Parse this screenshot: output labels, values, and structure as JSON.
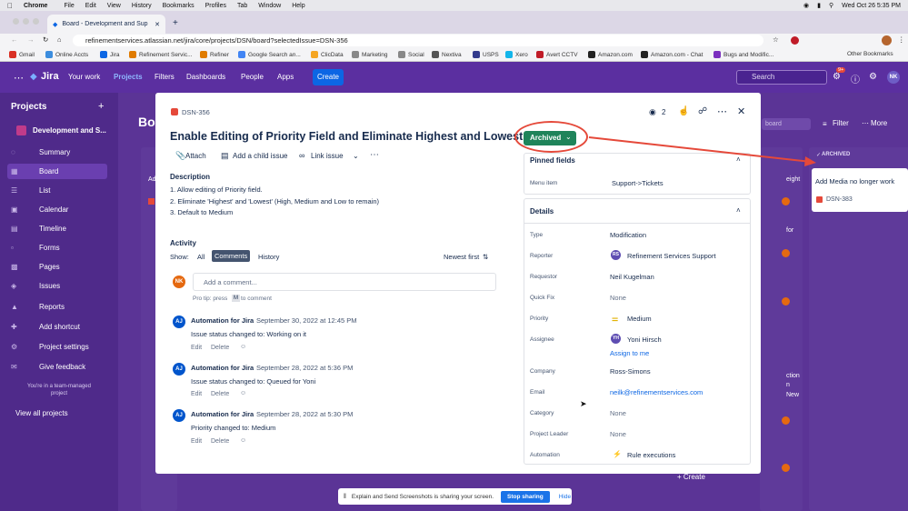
{
  "mac": {
    "app": "Chrome",
    "menus": [
      "File",
      "Edit",
      "View",
      "History",
      "Bookmarks",
      "Profiles",
      "Tab",
      "Window",
      "Help"
    ],
    "clock": "Wed Oct 26  5:35 PM"
  },
  "browser": {
    "tab_title": "Board - Development and Sup",
    "url": "refinementservices.atlassian.net/jira/core/projects/DSN/board?selectedIssue=DSN-356",
    "bookmarks": [
      "Gmail",
      "Online Accts",
      "Jira",
      "Refinement Servic...",
      "Refiner",
      "Google Search an...",
      "ClicData",
      "Marketing",
      "Social",
      "Nextiva",
      "USPS",
      "Xero",
      "Avert CCTV",
      "Amazon.com",
      "Amazon.com - Chat",
      "Bugs and Modific..."
    ],
    "other_bookmarks": "Other Bookmarks"
  },
  "jira_nav": {
    "logo": "Jira",
    "items": [
      "Your work",
      "Projects",
      "Filters",
      "Dashboards",
      "People",
      "Apps"
    ],
    "create": "Create",
    "search_placeholder": "Search",
    "notif_count": "9+",
    "avatar": "NK"
  },
  "sidebar": {
    "heading": "Projects",
    "project": "Development and S...",
    "items": [
      "Summary",
      "Board",
      "List",
      "Calendar",
      "Timeline",
      "Forms",
      "Pages",
      "Issues",
      "Reports",
      "Add shortcut",
      "Project settings",
      "Give feedback"
    ],
    "team_note": [
      "You're in a team-managed",
      "project"
    ],
    "view_all": "View all projects"
  },
  "board": {
    "title": "Boa",
    "board_search": "board",
    "filter": "Filter",
    "more": "More",
    "archived_header": "ARCHIVED",
    "archived_card": "Add Media no longer work",
    "archived_key": "DSN-383",
    "right_card_texts": [
      "eight",
      "for",
      "ction",
      "n",
      "New"
    ],
    "create": "+ Create"
  },
  "issue": {
    "key": "DSN-356",
    "watch_count": "2",
    "title": "Enable Editing of Priority Field and Eliminate Highest and Lowest",
    "status": "Archived",
    "actions": [
      "Attach",
      "Add a child issue",
      "Link issue"
    ],
    "desc_heading": "Description",
    "desc_lines": [
      "1. Allow editing of Priority field.",
      "2. Eliminate 'Highest' and 'Lowest' (High, Medium and Low to remain)",
      "3. Default to Medium"
    ],
    "activity": {
      "heading": "Activity",
      "show": "Show:",
      "filters": [
        "All",
        "Comments",
        "History"
      ],
      "sort": "Newest first",
      "comment_placeholder": "Add a comment...",
      "protip_a": "Pro tip: press",
      "protip_key": "M",
      "protip_b": "to comment",
      "entries": [
        {
          "author": "Automation for Jira",
          "date": "September 30, 2022 at 12:45 PM",
          "text": "Issue status changed to: Working on it"
        },
        {
          "author": "Automation for Jira",
          "date": "September 28, 2022 at 5:36 PM",
          "text": "Issue status changed to: Queued for Yoni"
        },
        {
          "author": "Automation for Jira",
          "date": "September 28, 2022 at 5:30 PM",
          "text": "Priority changed to: Medium"
        }
      ],
      "entry_actions": [
        "Edit",
        "Delete"
      ],
      "avatar": "AJ",
      "user_avatar": "NK"
    },
    "pinned": {
      "heading": "Pinned fields",
      "label": "Menu item",
      "value": "Support->Tickets"
    },
    "details": {
      "heading": "Details",
      "fields": [
        {
          "label": "Type",
          "value": "Modification"
        },
        {
          "label": "Reporter",
          "value": "Refinement Services Support"
        },
        {
          "label": "Requestor",
          "value": "Neil Kugelman"
        },
        {
          "label": "Quick Fix",
          "value": "None"
        },
        {
          "label": "Priority",
          "value": "Medium"
        },
        {
          "label": "Assignee",
          "value": "Yoni Hirsch"
        },
        {
          "label": "Company",
          "value": "Ross-Simons"
        },
        {
          "label": "Email",
          "value": "neilk@refinementservices.com"
        },
        {
          "label": "Category",
          "value": "None"
        },
        {
          "label": "Project Leader",
          "value": "None"
        },
        {
          "label": "Automation",
          "value": "Rule executions"
        }
      ],
      "assign_to_me": "Assign to me",
      "reporter_avatar": "RS",
      "assignee_avatar": "YH"
    }
  },
  "toast": {
    "text": "Explain and Send Screenshots is sharing your screen.",
    "stop": "Stop sharing",
    "hide": "Hide"
  },
  "colors": {
    "jira_purple": "#5b2fa0",
    "status_green": "#1f845a",
    "annotation_red": "#e5493a",
    "link_blue": "#0c66e4"
  }
}
